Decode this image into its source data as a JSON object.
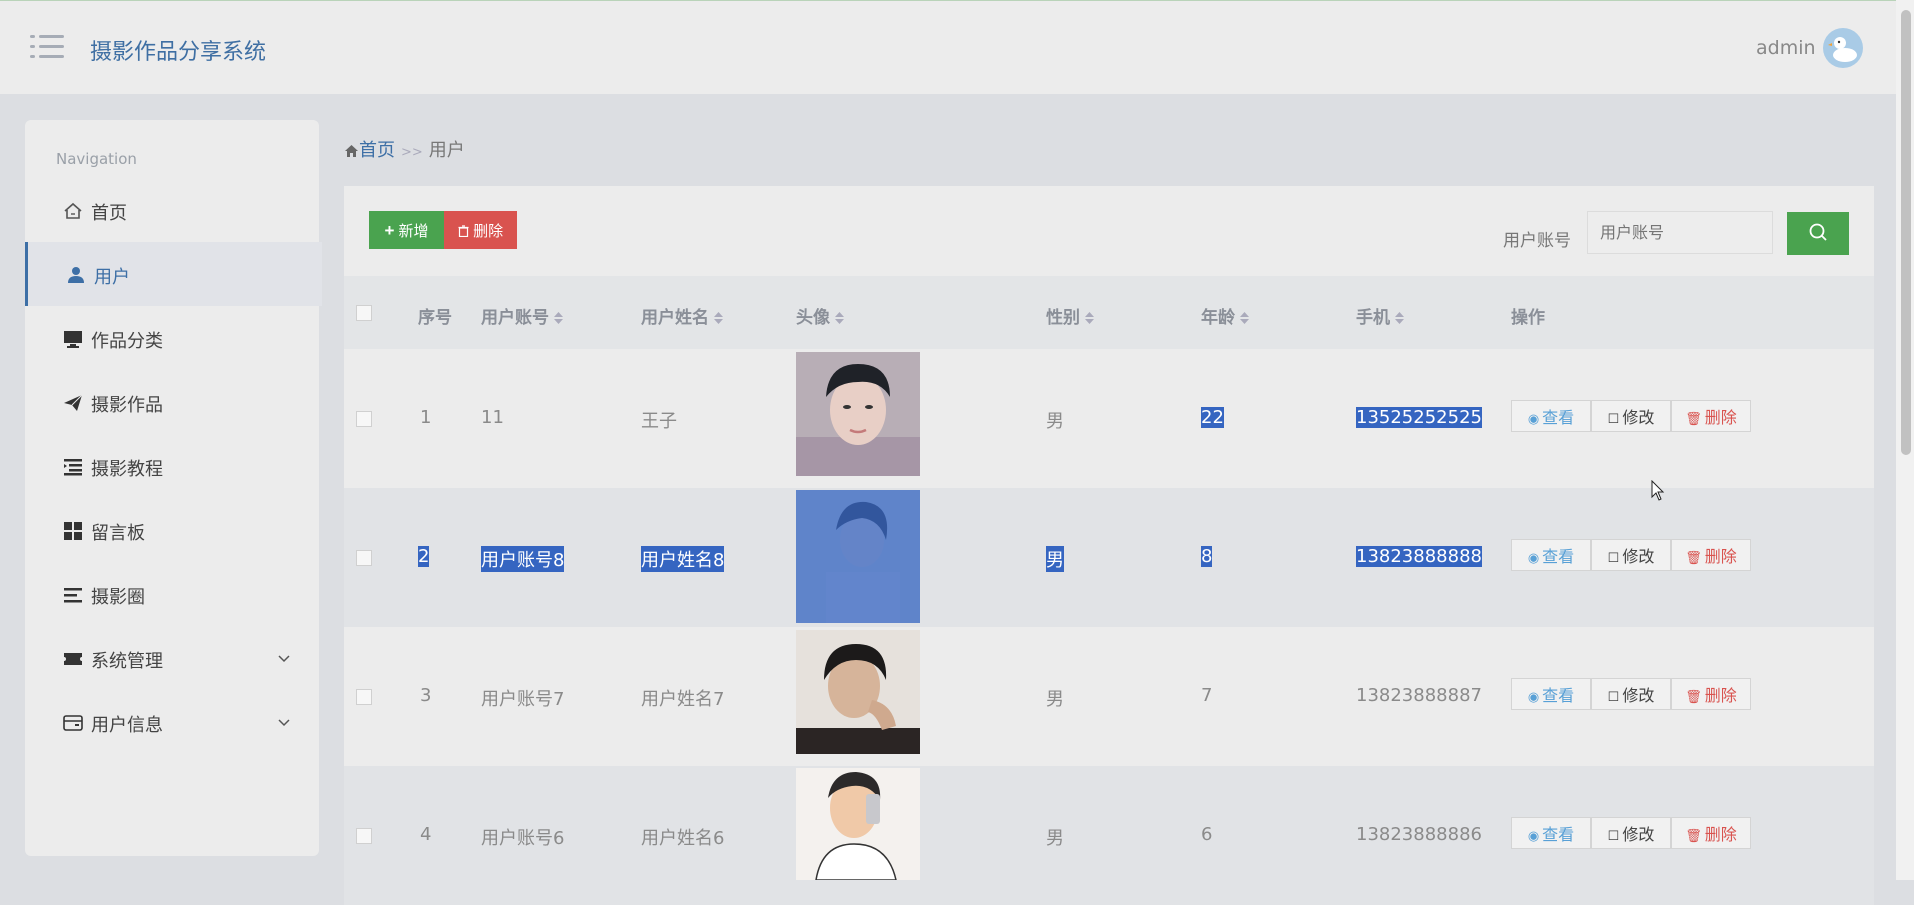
{
  "app": {
    "title": "摄影作品分享系统",
    "user": "admin"
  },
  "sidebar": {
    "heading": "Navigation",
    "items": [
      {
        "label": "首页",
        "icon": "home-icon"
      },
      {
        "label": "用户",
        "icon": "user-icon",
        "active": true
      },
      {
        "label": "作品分类",
        "icon": "monitor-icon"
      },
      {
        "label": "摄影作品",
        "icon": "paper-plane-icon"
      },
      {
        "label": "摄影教程",
        "icon": "list-indent-icon"
      },
      {
        "label": "留言板",
        "icon": "grid-icon"
      },
      {
        "label": "摄影圈",
        "icon": "list-lines-icon"
      },
      {
        "label": "系统管理",
        "icon": "ticket-icon",
        "expandable": true
      },
      {
        "label": "用户信息",
        "icon": "wallet-icon",
        "expandable": true
      }
    ]
  },
  "breadcrumb": {
    "home": "首页",
    "separator": ">>",
    "current": "用户"
  },
  "toolbar": {
    "add_label": "新增",
    "delete_label": "删除",
    "search_label": "用户账号",
    "search_placeholder": "用户账号"
  },
  "table": {
    "columns": [
      "序号",
      "用户账号",
      "用户姓名",
      "头像",
      "性别",
      "年龄",
      "手机",
      "操作"
    ],
    "rows": [
      {
        "index": "1",
        "account": "11",
        "name": "王子",
        "gender": "男",
        "age": "22",
        "phone": "13525252525"
      },
      {
        "index": "2",
        "account": "用户账号8",
        "name": "用户姓名8",
        "gender": "男",
        "age": "8",
        "phone": "13823888888"
      },
      {
        "index": "3",
        "account": "用户账号7",
        "name": "用户姓名7",
        "gender": "男",
        "age": "7",
        "phone": "13823888887"
      },
      {
        "index": "4",
        "account": "用户账号6",
        "name": "用户姓名6",
        "gender": "男",
        "age": "6",
        "phone": "13823888886"
      }
    ],
    "actions": {
      "view": "查看",
      "edit": "修改",
      "delete": "删除"
    }
  },
  "colors": {
    "accent": "#3d6fa6",
    "success": "#4aa34f",
    "danger": "#d9534f",
    "selection": "#3565c1"
  }
}
